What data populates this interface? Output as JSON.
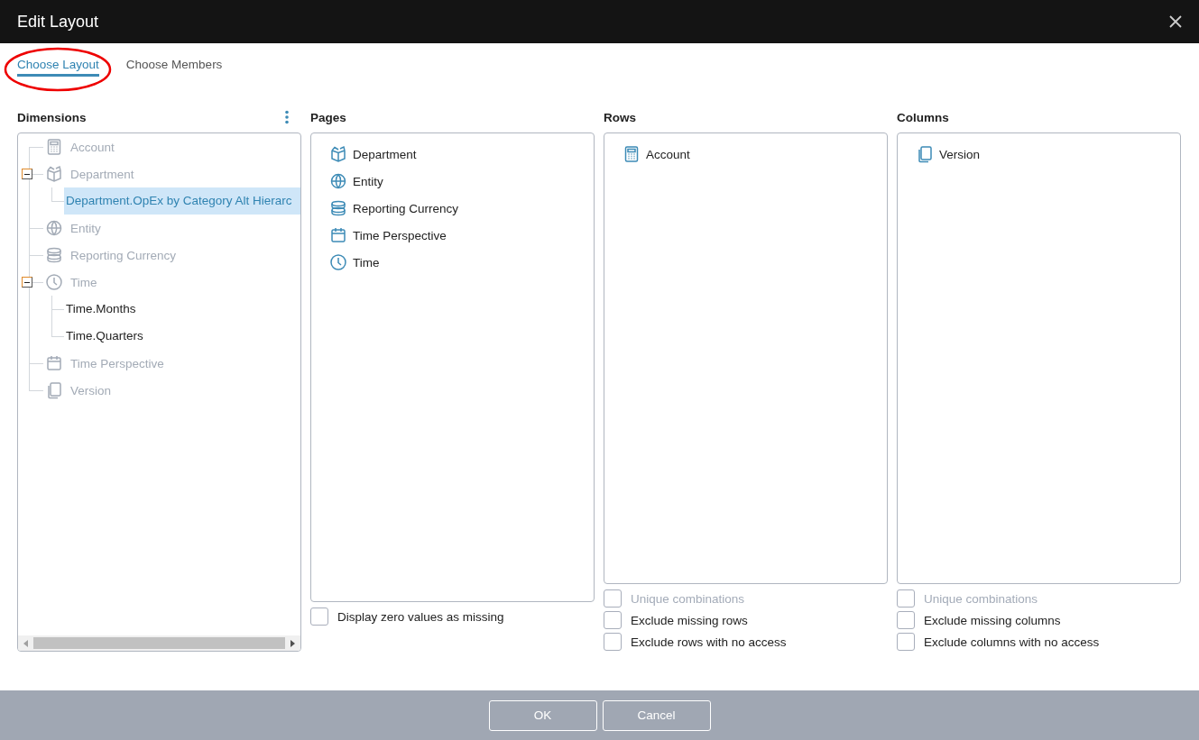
{
  "window": {
    "title": "Edit Layout"
  },
  "tabs": [
    {
      "label": "Choose Layout",
      "selected": true
    },
    {
      "label": "Choose Members",
      "selected": false
    }
  ],
  "dimensions": {
    "title": "Dimensions",
    "items": [
      {
        "label": "Account",
        "kind": "calculator",
        "disabled": true,
        "selected": false
      },
      {
        "label": "Department",
        "kind": "cube",
        "disabled": true,
        "selected": false,
        "expanded": true,
        "children": [
          {
            "label": "Department.OpEx by Category Alt Hierarc",
            "disabled": false,
            "selected": true
          }
        ]
      },
      {
        "label": "Entity",
        "kind": "globe",
        "disabled": true,
        "selected": false
      },
      {
        "label": "Reporting Currency",
        "kind": "coins",
        "disabled": true,
        "selected": false
      },
      {
        "label": "Time",
        "kind": "clock",
        "disabled": true,
        "selected": false,
        "expanded": true,
        "children": [
          {
            "label": "Time.Months",
            "disabled": false,
            "selected": false
          },
          {
            "label": "Time.Quarters",
            "disabled": false,
            "selected": false
          }
        ]
      },
      {
        "label": "Time Perspective",
        "kind": "calendar",
        "disabled": true,
        "selected": false
      },
      {
        "label": "Version",
        "kind": "copy",
        "disabled": true,
        "selected": false
      }
    ]
  },
  "pages": {
    "title": "Pages",
    "items": [
      {
        "label": "Department",
        "kind": "cube"
      },
      {
        "label": "Entity",
        "kind": "globe"
      },
      {
        "label": "Reporting Currency",
        "kind": "coins"
      },
      {
        "label": "Time Perspective",
        "kind": "calendar"
      },
      {
        "label": "Time",
        "kind": "clock"
      }
    ],
    "options": [
      {
        "label": "Display zero values as missing",
        "checked": false,
        "disabled": false
      }
    ]
  },
  "rows": {
    "title": "Rows",
    "items": [
      {
        "label": "Account",
        "kind": "calculator"
      }
    ],
    "options": [
      {
        "label": "Unique combinations",
        "checked": false,
        "disabled": true
      },
      {
        "label": "Exclude missing rows",
        "checked": false,
        "disabled": false
      },
      {
        "label": "Exclude rows with no access",
        "checked": false,
        "disabled": false
      }
    ]
  },
  "columns": {
    "title": "Columns",
    "items": [
      {
        "label": "Version",
        "kind": "copy"
      }
    ],
    "options": [
      {
        "label": "Unique combinations",
        "checked": false,
        "disabled": true
      },
      {
        "label": "Exclude missing columns",
        "checked": false,
        "disabled": false
      },
      {
        "label": "Exclude columns with no access",
        "checked": false,
        "disabled": false
      }
    ]
  },
  "buttons": [
    "OK",
    "Cancel"
  ]
}
